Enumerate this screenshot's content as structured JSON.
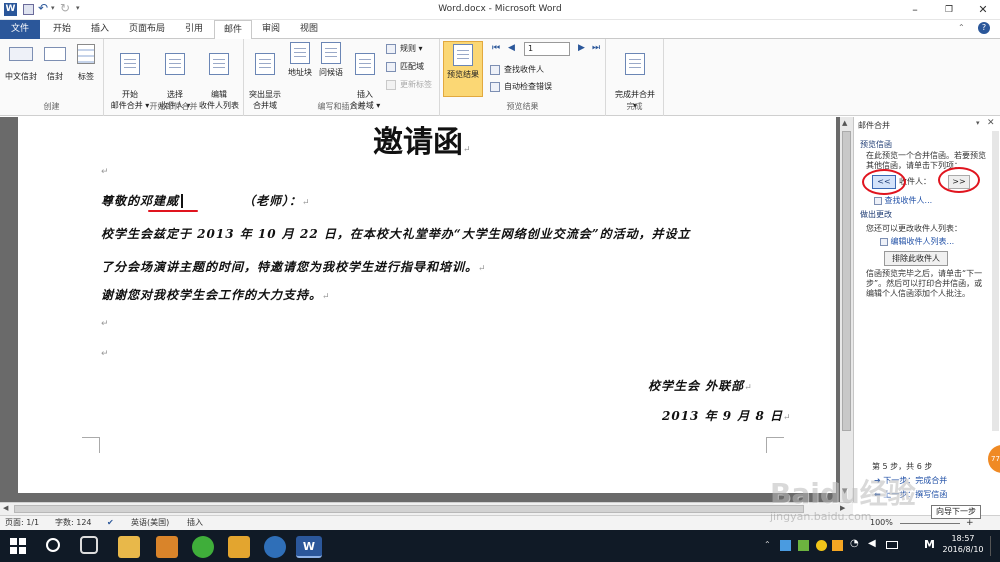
{
  "window": {
    "title": "Word.docx - Microsoft Word",
    "help": "?"
  },
  "tabs": [
    "文件",
    "开始",
    "插入",
    "页面布局",
    "引用",
    "邮件",
    "审阅",
    "视图"
  ],
  "ribbon": {
    "groups": {
      "create": {
        "label": "创建",
        "buttons": [
          "中文信封",
          "信封",
          "标签"
        ]
      },
      "start_merge": {
        "label": "开始邮件合并",
        "buttons": [
          "开始\n邮件合并 ▾",
          "选择\n收件人 ▾",
          "编辑\n收件人列表"
        ]
      },
      "write_insert": {
        "label": "编写和插入域",
        "buttons": [
          "突出显示\n合并域",
          "地址块",
          "问候语",
          "插入\n合并域 ▾"
        ],
        "small": [
          "规则 ▾",
          "匹配域",
          "更新标签"
        ]
      },
      "preview": {
        "label": "预览结果",
        "big": "预览结果",
        "record": "1",
        "small": [
          "查找收件人",
          "自动检查错误"
        ]
      },
      "finish": {
        "label": "完成",
        "big": "完成并合并\n▾"
      }
    }
  },
  "document": {
    "heading": "邀请函",
    "salutation_prefix": "尊敬的",
    "recipient_name": "邓建威",
    "salutation_suffix": "（老师）：",
    "paragraphs": [
      "校学生会兹定于 2013 年 10 月 22 日，在本校大礼堂举办“大学生网络创业交流会”的活动，并设立",
      "了分会场演讲主题的时间，特邀请您为我校学生进行指导和培训。",
      "谢谢您对我校学生会工作的大力支持。"
    ],
    "signature": "校学生会 外联部",
    "date": "2013 年 9 月 8 日"
  },
  "pane": {
    "title": "邮件合并",
    "section_preview": "预览信函",
    "preview_text": "在此预览一个合并信函。若要预览其他信函，请单击下列项：",
    "recipient_label": "收件人：",
    "prev_button": "<<",
    "next_button": ">>",
    "find_link": "查找收件人...",
    "section_changes": "做出更改",
    "changes_text": "您还可以更改收件人列表：",
    "edit_list_link": "编辑收件人列表...",
    "exclude_button": "排除此收件人",
    "after_text": "信函预览完毕之后，请单击“下一步”。然后可以打印合并信函，或编辑个人信函添加个人批注。",
    "step": "第 5 步，共 6 步",
    "next_step_link": "下一步：完成合并",
    "prev_step_link": "上一步：撰写信函",
    "tooltip": "向导下一步"
  },
  "statusbar": {
    "page": "页面: 1/1",
    "words": "字数: 124",
    "language": "英语(美国)",
    "mode": "插入",
    "zoom": "100%"
  },
  "taskbar": {
    "time": "18:57",
    "date": "2016/8/10",
    "ime": "M"
  },
  "watermark": {
    "line1": "Baidu经验",
    "line2": "jingyan.baidu.com"
  },
  "colors": {
    "accent": "#2b579a",
    "annotation": "#e0141e",
    "taskbar": "#101a26"
  }
}
